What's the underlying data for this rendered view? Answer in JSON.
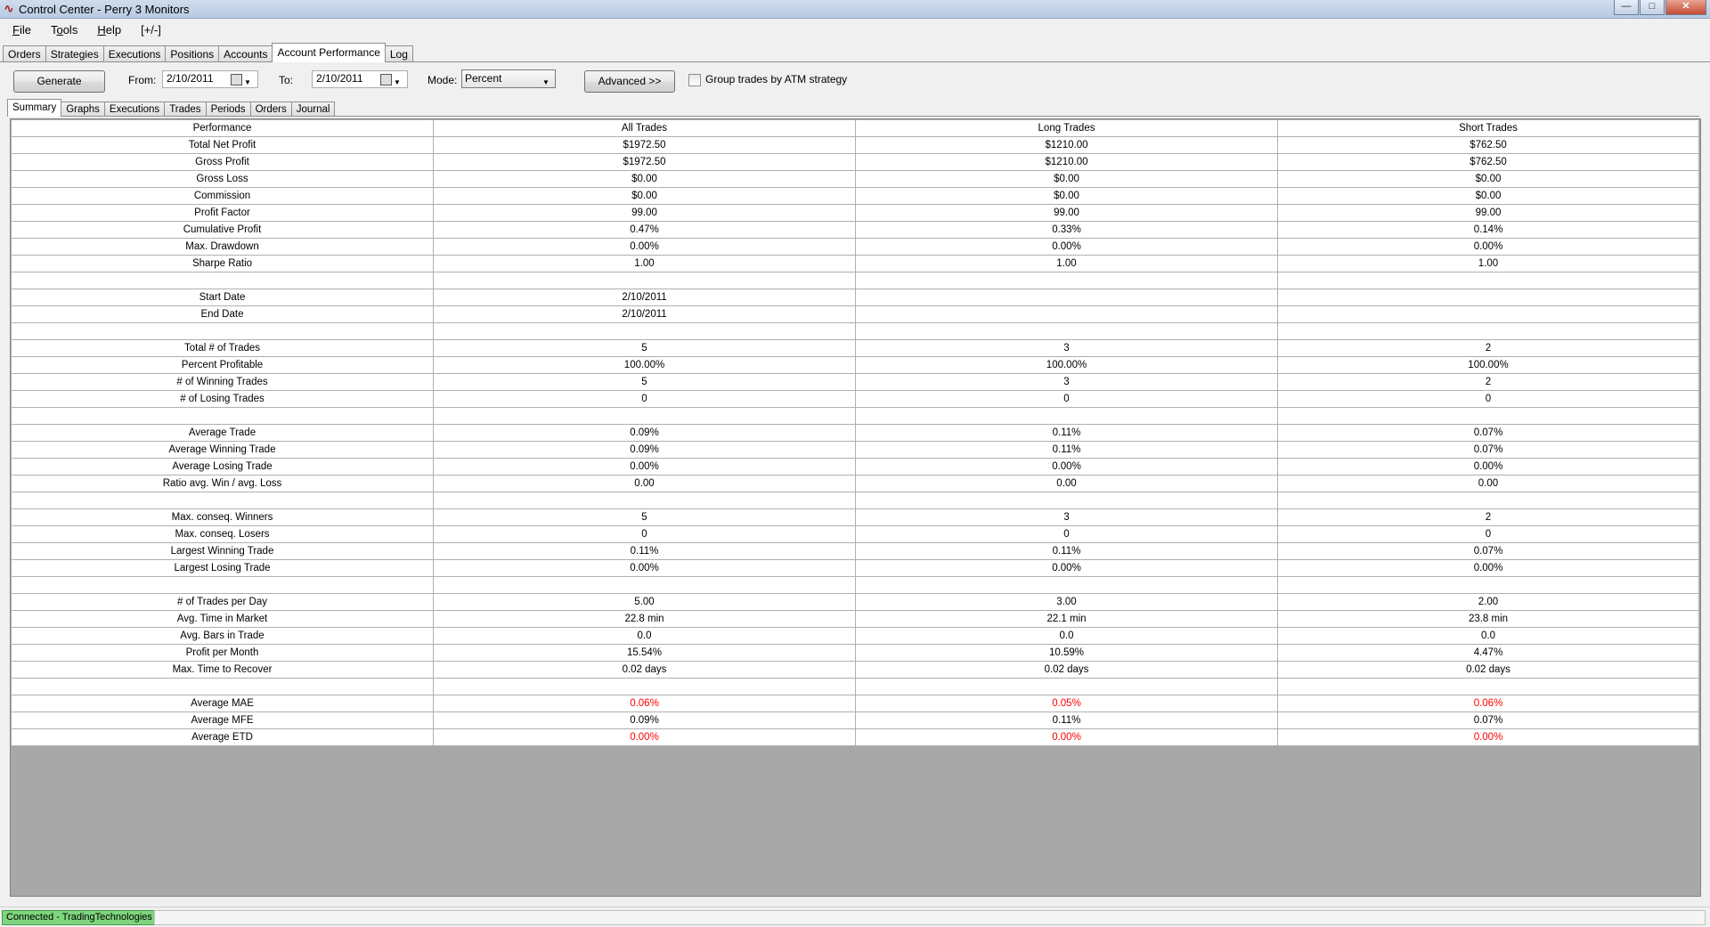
{
  "window": {
    "title": "Control Center - Perry 3 Monitors",
    "icon": "ninjatrader-logo-icon",
    "controls": {
      "minimize": "—",
      "maximize": "□",
      "close": "✕"
    }
  },
  "menu": {
    "items": [
      {
        "label": "File"
      },
      {
        "label": "Tools"
      },
      {
        "label": "Help"
      },
      {
        "label": "[+/-]"
      }
    ]
  },
  "main_tabs": [
    {
      "label": "Orders"
    },
    {
      "label": "Strategies"
    },
    {
      "label": "Executions"
    },
    {
      "label": "Positions"
    },
    {
      "label": "Accounts"
    },
    {
      "label": "Account Performance",
      "active": true
    },
    {
      "label": "Log"
    }
  ],
  "toolbar": {
    "generate_label": "Generate",
    "from_label": "From:",
    "from_value": "2/10/2011",
    "to_label": "To:",
    "to_value": "2/10/2011",
    "mode_label": "Mode:",
    "mode_value": "Percent",
    "advanced_label": "Advanced >>",
    "group_label": "Group trades by ATM strategy",
    "group_checked": false
  },
  "sub_tabs": [
    {
      "label": "Summary",
      "active": true
    },
    {
      "label": "Graphs"
    },
    {
      "label": "Executions"
    },
    {
      "label": "Trades"
    },
    {
      "label": "Periods"
    },
    {
      "label": "Orders"
    },
    {
      "label": "Journal"
    }
  ],
  "performance": {
    "headers": [
      "Performance",
      "All Trades",
      "Long Trades",
      "Short Trades"
    ],
    "negative_color": "#ff0000",
    "rows": [
      {
        "label": "Total Net Profit",
        "all": "$1972.50",
        "long": "$1210.00",
        "short": "$762.50"
      },
      {
        "label": "Gross Profit",
        "all": "$1972.50",
        "long": "$1210.00",
        "short": "$762.50"
      },
      {
        "label": "Gross Loss",
        "all": "$0.00",
        "long": "$0.00",
        "short": "$0.00"
      },
      {
        "label": "Commission",
        "all": "$0.00",
        "long": "$0.00",
        "short": "$0.00"
      },
      {
        "label": "Profit Factor",
        "all": "99.00",
        "long": "99.00",
        "short": "99.00"
      },
      {
        "label": "Cumulative Profit",
        "all": "0.47%",
        "long": "0.33%",
        "short": "0.14%"
      },
      {
        "label": "Max. Drawdown",
        "all": "0.00%",
        "long": "0.00%",
        "short": "0.00%"
      },
      {
        "label": "Sharpe Ratio",
        "all": "1.00",
        "long": "1.00",
        "short": "1.00"
      },
      {
        "label": "",
        "all": "",
        "long": "",
        "short": ""
      },
      {
        "label": "Start Date",
        "all": "2/10/2011",
        "long": "",
        "short": ""
      },
      {
        "label": "End Date",
        "all": "2/10/2011",
        "long": "",
        "short": ""
      },
      {
        "label": "",
        "all": "",
        "long": "",
        "short": ""
      },
      {
        "label": "Total # of Trades",
        "all": "5",
        "long": "3",
        "short": "2"
      },
      {
        "label": "Percent Profitable",
        "all": "100.00%",
        "long": "100.00%",
        "short": "100.00%"
      },
      {
        "label": "# of Winning Trades",
        "all": "5",
        "long": "3",
        "short": "2"
      },
      {
        "label": "# of Losing Trades",
        "all": "0",
        "long": "0",
        "short": "0"
      },
      {
        "label": "",
        "all": "",
        "long": "",
        "short": ""
      },
      {
        "label": "Average Trade",
        "all": "0.09%",
        "long": "0.11%",
        "short": "0.07%"
      },
      {
        "label": "Average Winning Trade",
        "all": "0.09%",
        "long": "0.11%",
        "short": "0.07%"
      },
      {
        "label": "Average Losing Trade",
        "all": "0.00%",
        "long": "0.00%",
        "short": "0.00%"
      },
      {
        "label": "Ratio avg. Win / avg. Loss",
        "all": "0.00",
        "long": "0.00",
        "short": "0.00"
      },
      {
        "label": "",
        "all": "",
        "long": "",
        "short": ""
      },
      {
        "label": "Max. conseq. Winners",
        "all": "5",
        "long": "3",
        "short": "2"
      },
      {
        "label": "Max. conseq. Losers",
        "all": "0",
        "long": "0",
        "short": "0"
      },
      {
        "label": "Largest Winning Trade",
        "all": "0.11%",
        "long": "0.11%",
        "short": "0.07%"
      },
      {
        "label": "Largest Losing Trade",
        "all": "0.00%",
        "long": "0.00%",
        "short": "0.00%"
      },
      {
        "label": "",
        "all": "",
        "long": "",
        "short": ""
      },
      {
        "label": "# of Trades per Day",
        "all": "5.00",
        "long": "3.00",
        "short": "2.00"
      },
      {
        "label": "Avg. Time in Market",
        "all": "22.8 min",
        "long": "22.1 min",
        "short": "23.8 min"
      },
      {
        "label": "Avg. Bars in Trade",
        "all": "0.0",
        "long": "0.0",
        "short": "0.0"
      },
      {
        "label": "Profit per Month",
        "all": "15.54%",
        "long": "10.59%",
        "short": "4.47%"
      },
      {
        "label": "Max. Time to Recover",
        "all": "0.02 days",
        "long": "0.02 days",
        "short": "0.02 days"
      },
      {
        "label": "",
        "all": "",
        "long": "",
        "short": ""
      },
      {
        "label": "Average MAE",
        "all": "0.06%",
        "long": "0.05%",
        "short": "0.06%",
        "negative": true
      },
      {
        "label": "Average MFE",
        "all": "0.09%",
        "long": "0.11%",
        "short": "0.07%"
      },
      {
        "label": "Average ETD",
        "all": "0.00%",
        "long": "0.00%",
        "short": "0.00%",
        "negative": true
      }
    ]
  },
  "status": {
    "connection": "Connected - TradingTechnologies",
    "connection_color": "#7ed57e"
  }
}
